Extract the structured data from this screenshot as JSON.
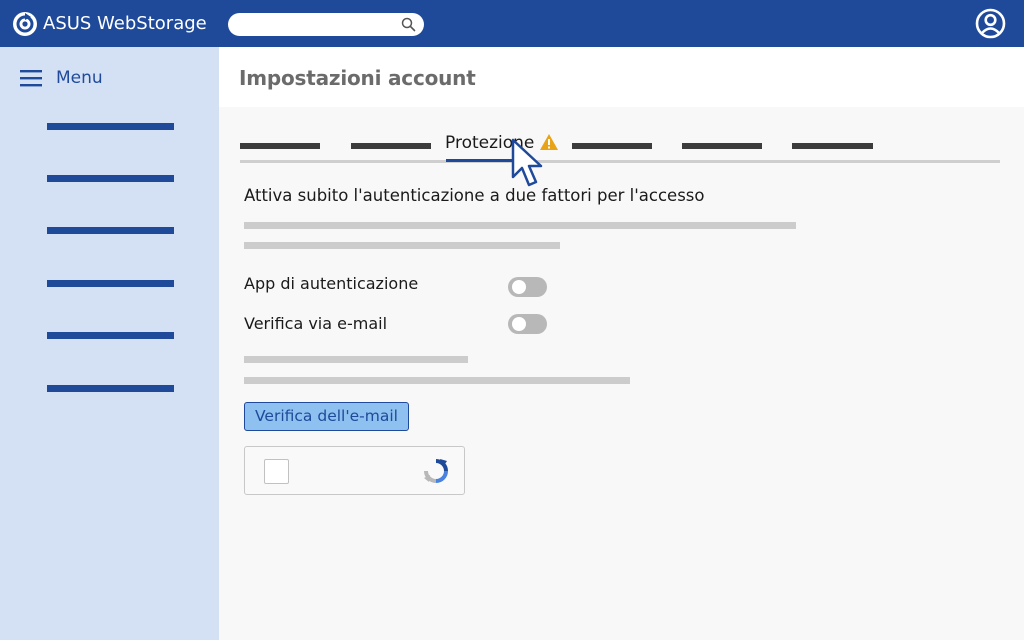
{
  "topbar": {
    "brand": "ASUS WebStorage",
    "logo_icon": "asus-webstorage-logo-icon",
    "search": {
      "value": "",
      "placeholder": "",
      "icon": "search-icon"
    },
    "user_icon": "user-avatar-icon"
  },
  "sidebar": {
    "menu_label": "Menu",
    "menu_icon": "hamburger-icon",
    "items": [
      "",
      "",
      "",
      "",
      "",
      ""
    ]
  },
  "page": {
    "title": "Impostazioni account"
  },
  "tabs": {
    "items": [
      "",
      "",
      "Protezione",
      "",
      "",
      ""
    ],
    "active_index": 2,
    "active_label": "Protezione",
    "active_badge_icon": "warning-icon"
  },
  "security": {
    "heading": "Attiva subito l'autenticazione a due fattori per l'accesso",
    "options": [
      {
        "label": "App di autenticazione",
        "enabled": false
      },
      {
        "label": "Verifica via e-mail",
        "enabled": false
      }
    ],
    "verify_button": "Verifica dell'e-mail",
    "captcha": {
      "checked": false,
      "icon": "recaptcha-icon"
    }
  },
  "colors": {
    "brand_blue": "#1f4a9a",
    "sidebar_bg": "#d4e0f3",
    "button_bg": "#8ec0f0",
    "warning": "#e8a317",
    "toggle_off": "#b8b8b8"
  }
}
